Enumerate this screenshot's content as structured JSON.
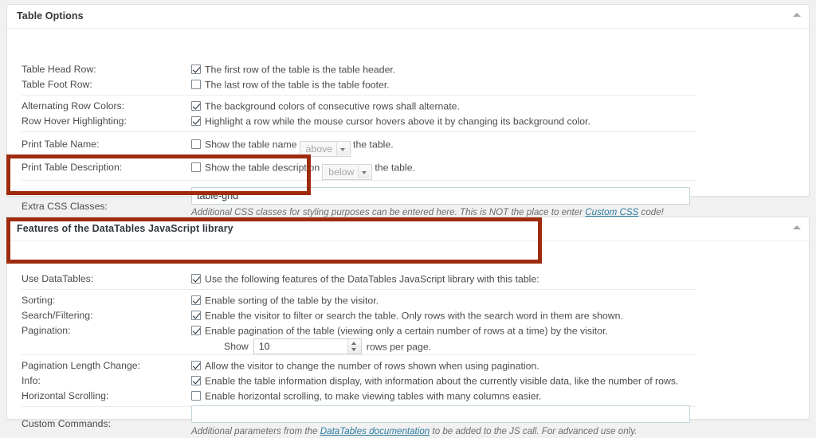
{
  "panels": [
    {
      "id": "table-options",
      "title": "Table Options",
      "toggle_icon": "chevron-up-icon"
    },
    {
      "id": "datatables-features",
      "title": "Features of the DataTables JavaScript library",
      "toggle_icon": "chevron-up-icon"
    }
  ],
  "table_options": {
    "table_head_row": {
      "label": "Table Head Row:",
      "checked": true,
      "text": "The first row of the table is the table header."
    },
    "table_foot_row": {
      "label": "Table Foot Row:",
      "checked": false,
      "text": "The last row of the table is the table footer."
    },
    "alternating_row_colors": {
      "label": "Alternating Row Colors:",
      "checked": true,
      "text": "The background colors of consecutive rows shall alternate."
    },
    "row_hover_highlighting": {
      "label": "Row Hover Highlighting:",
      "checked": true,
      "text": "Highlight a row while the mouse cursor hovers above it by changing its background color."
    },
    "print_table_name": {
      "label": "Print Table Name:",
      "checked": false,
      "text_before": "Show the table name",
      "select_value": "above",
      "select_options": [
        "above",
        "below"
      ],
      "text_after": "the table."
    },
    "print_table_description": {
      "label": "Print Table Description:",
      "checked": false,
      "text_before": "Show the table description",
      "select_value": "below",
      "select_options": [
        "above",
        "below"
      ],
      "text_after": "the table."
    },
    "extra_css_classes": {
      "label": "Extra CSS Classes:",
      "value": "table-grid",
      "placeholder": "",
      "desc_part1": "Additional CSS classes for styling purposes can be entered here. This is NOT the place to enter ",
      "desc_link": "Custom CSS",
      "desc_part2": " code!"
    }
  },
  "datatables": {
    "use_datatables": {
      "label": "Use DataTables:",
      "checked": true,
      "text": "Use the following features of the DataTables JavaScript library with this table:"
    },
    "sorting": {
      "label": "Sorting:",
      "checked": true,
      "text": "Enable sorting of the table by the visitor."
    },
    "search_filtering": {
      "label": "Search/Filtering:",
      "checked": true,
      "text": "Enable the visitor to filter or search the table. Only rows with the search word in them are shown."
    },
    "pagination": {
      "label": "Pagination:",
      "checked": true,
      "text": "Enable pagination of the table (viewing only a certain number of rows at a time) by the visitor.",
      "show_label": "Show",
      "rows_per_page": "10",
      "rows_suffix": "rows per page."
    },
    "pagination_length_change": {
      "label": "Pagination Length Change:",
      "checked": true,
      "text": "Allow the visitor to change the number of rows shown when using pagination."
    },
    "info": {
      "label": "Info:",
      "checked": true,
      "text": "Enable the table information display, with information about the currently visible data, like the number of rows."
    },
    "horizontal_scrolling": {
      "label": "Horizontal Scrolling:",
      "checked": false,
      "text": "Enable horizontal scrolling, to make viewing tables with many columns easier."
    },
    "custom_commands": {
      "label": "Custom Commands:",
      "value": "",
      "placeholder": "",
      "desc_part1": "Additional parameters from the ",
      "desc_link": "DataTables documentation",
      "desc_part2": " to be added to the JS call. For advanced use only."
    }
  },
  "highlights": [
    {
      "name": "extra-css-classes-highlight",
      "color": "#9e2b0e"
    },
    {
      "name": "datatables-features-highlight",
      "color": "#9e2b0e"
    }
  ]
}
